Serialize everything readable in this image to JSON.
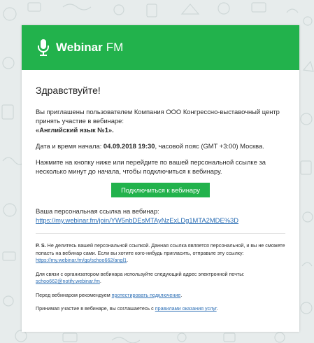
{
  "brand": {
    "name": "Webinar",
    "suffix": "FM",
    "color": "#22b24c",
    "icon": "microphone-icon"
  },
  "greeting": "Здравствуйте!",
  "invite": {
    "text": "Вы приглашены пользователем Компания ООО Конгрессно-выставочный центр принять участие в вебинаре:",
    "title": "«Английский язык №1»."
  },
  "datetime": {
    "label": "Дата и время начала:",
    "value": "04.09.2018 19:30",
    "rest": ", часовой пояс (GMT +3:00) Москва."
  },
  "instruction": "Нажмите на кнопку ниже или перейдите по вашей персональной ссылке за несколько минут до начала, чтобы подключиться к вебинару.",
  "connect_button": "Подключиться к вебинару",
  "personal_link": {
    "label": "Ваша персональная ссылка на вебинар:",
    "url": "https://my.webinar.fm/join/YW5nbDEsMTAyNzExLDg1MTA2MDE%3D"
  },
  "ps": {
    "prefix": "P. S.",
    "text": " Не делитесь вашей персональной ссылкой. Данная ссылка является персональной, и вы не сможете попасть на вебинар сами. Если вы хотите кого-нибудь пригласить, отправьте эту ссылку: ",
    "link": "https://my.webinar.fm/go/schoo662/angl1",
    "end": "."
  },
  "contact": {
    "text": "Для связи с организатором вебинара используйте следующий адрес электронной почты: ",
    "email": "schoo662@notify.webinar.fm",
    "end": "."
  },
  "recommend": {
    "text": "Перед вебинаром рекомендуем ",
    "link": "протестировать подключение",
    "end": "."
  },
  "terms": {
    "text": "Принимая участие в вебинаре, вы соглашаетесь с ",
    "link": "правилами оказания услуг",
    "end": "."
  }
}
